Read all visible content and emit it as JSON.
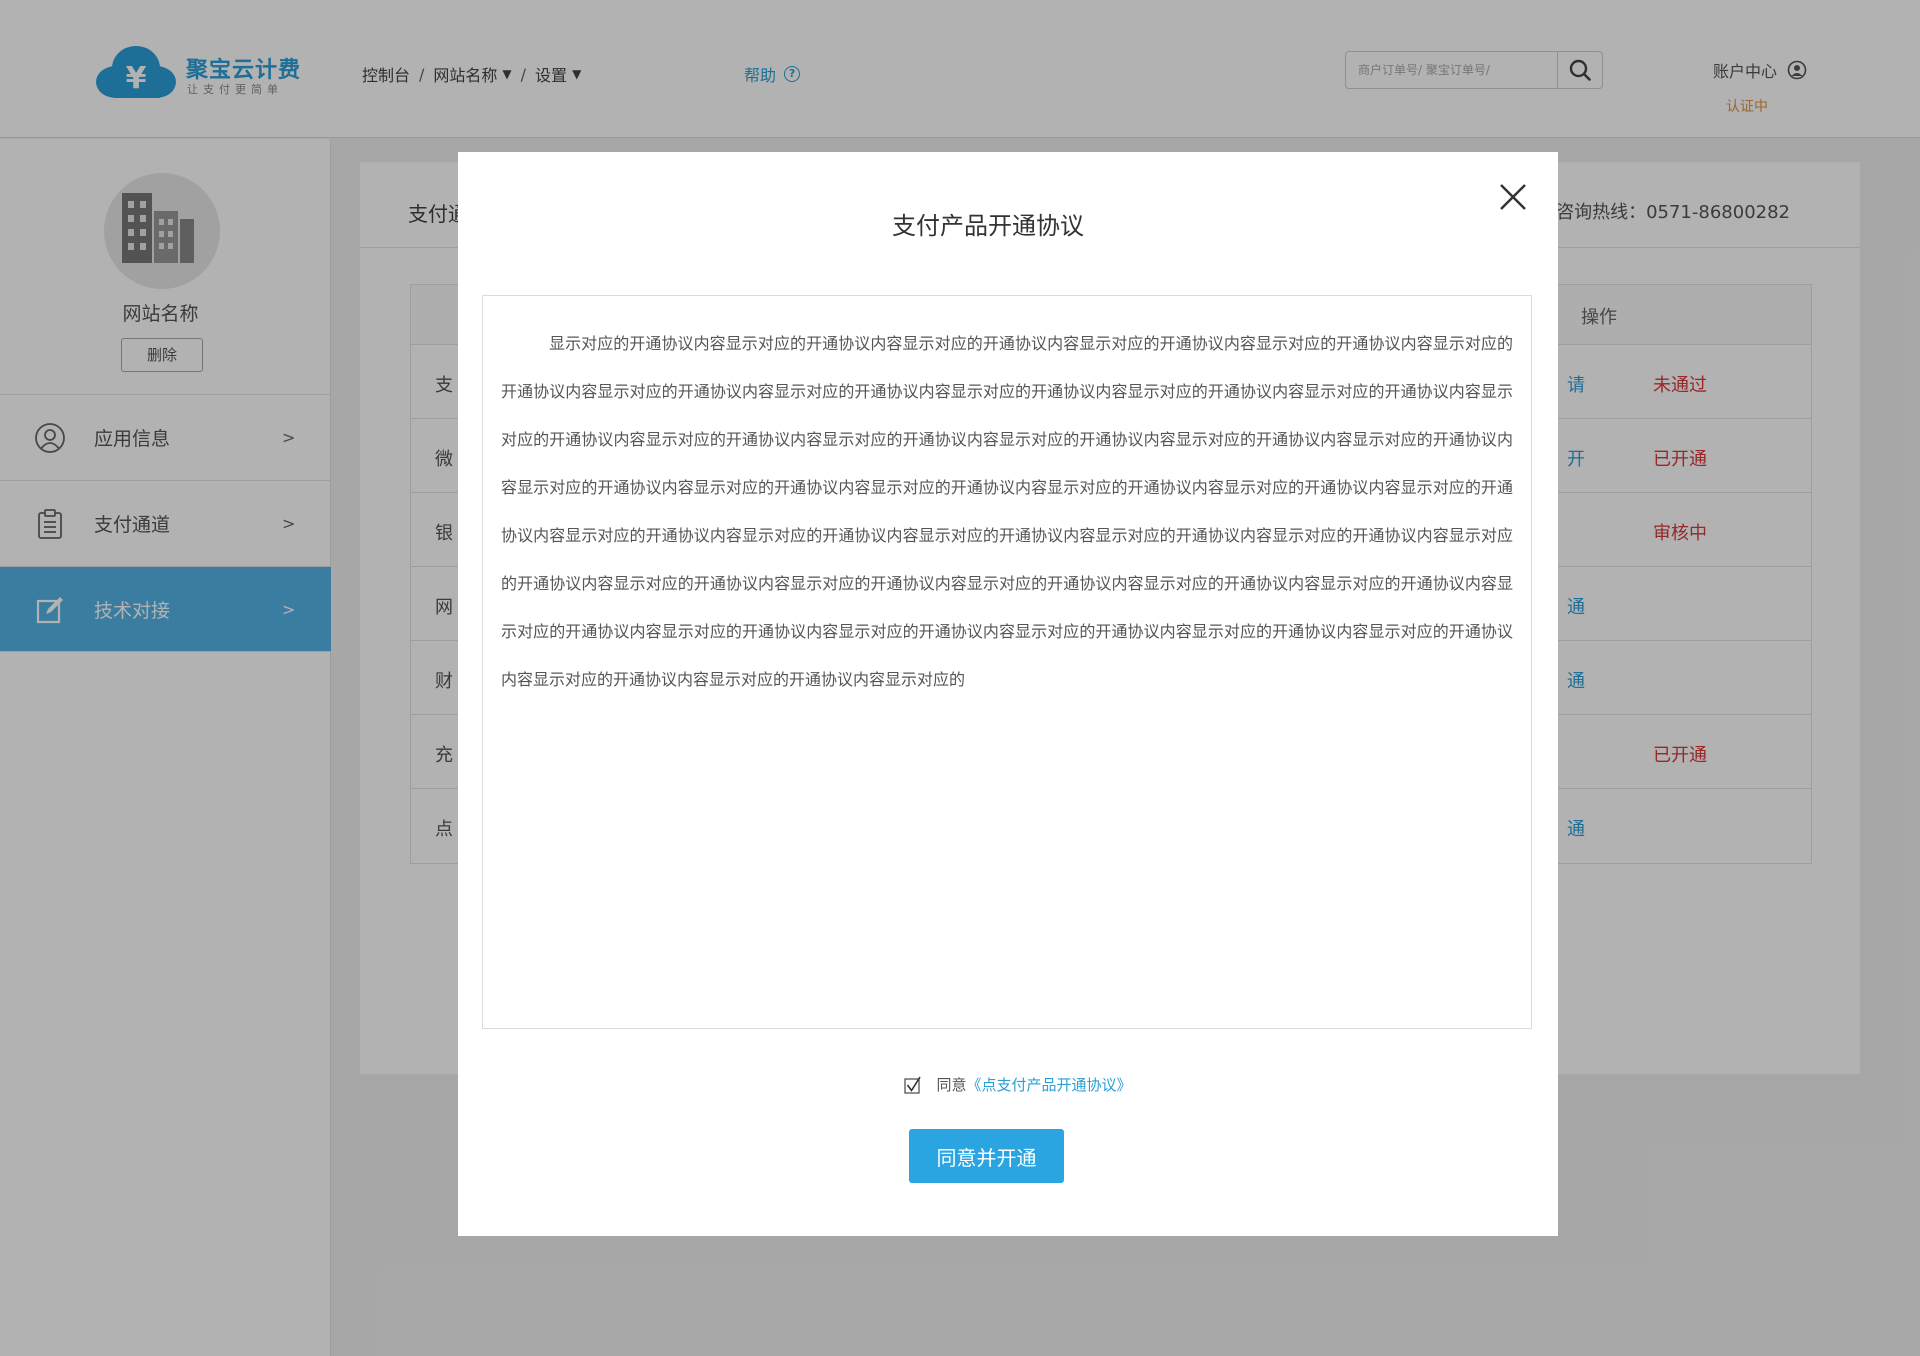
{
  "header": {
    "logo_title": "聚宝云计费",
    "logo_subtitle": "让支付更简单",
    "breadcrumb": [
      "控制台",
      "网站名称",
      "设置"
    ],
    "help_label": "帮助",
    "search_placeholder": "商户订单号/ 聚宝订单号/",
    "account_label": "账户中心",
    "cert_status": "认证中"
  },
  "sidebar": {
    "site_name": "网站名称",
    "delete_label": "删除",
    "items": [
      {
        "label": "应用信息",
        "arrow": ">",
        "icon": "user-circle-icon"
      },
      {
        "label": "支付通道",
        "arrow": ">",
        "icon": "clipboard-icon"
      },
      {
        "label": "技术对接",
        "arrow": ">",
        "icon": "edit-icon",
        "active": true
      }
    ]
  },
  "main": {
    "title": "支付通",
    "hotline": "咨询热线：0571-86800282",
    "table": {
      "op_header": "操作",
      "rows": [
        {
          "name": "支",
          "action": "请",
          "status": "未通过"
        },
        {
          "name": "微",
          "action": "开",
          "status": "已开通"
        },
        {
          "name": "银",
          "action": "",
          "status": "审核中"
        },
        {
          "name": "网",
          "action": "通",
          "status": ""
        },
        {
          "name": "财",
          "action": "通",
          "status": ""
        },
        {
          "name": "充",
          "action": "",
          "status": "已开通"
        },
        {
          "name": "点",
          "action": "通",
          "status": ""
        }
      ]
    }
  },
  "modal": {
    "title": "支付产品开通协议",
    "agreement_text": "显示对应的开通协议内容显示对应的开通协议内容显示对应的开通协议内容显示对应的开通协议内容显示对应的开通协议内容显示对应的开通协议内容显示对应的开通协议内容显示对应的开通协议内容显示对应的开通协议内容显示对应的开通协议内容显示对应的开通协议内容显示对应的开通协议内容显示对应的开通协议内容显示对应的开通协议内容显示对应的开通协议内容显示对应的开通协议内容显示对应的开通协议内容显示对应的开通协议内容显示对应的开通协议内容显示对应的开通协议内容显示对应的开通协议内容显示对应的开通协议内容显示对应的开通协议内容显示对应的开通协议内容显示对应的开通协议内容显示对应的开通协议内容显示对应的开通协议内容显示对应的开通协议内容显示对应的开通协议内容显示对应的开通协议内容显示对应的开通协议内容显示对应的开通协议内容显示对应的开通协议内容显示对应的开通协议内容显示对应的开通协议内容显示对应的开通协议内容显示对应的开通协议内容显示对应的开通协议内容显示对应的开通协议内容显示对应的开通协议内容显示对应的开通协议内容显示对应的开通协议内容显示对应的",
    "agree_prefix": "同意",
    "agree_link": "《点支付产品开通协议》",
    "submit_label": "同意并开通",
    "checkbox_checked": true
  },
  "colors": {
    "accent": "#2aa5e2",
    "sidebar_active": "#55b4e6",
    "status_red": "#d9383a",
    "cert_orange": "#e0913f"
  }
}
